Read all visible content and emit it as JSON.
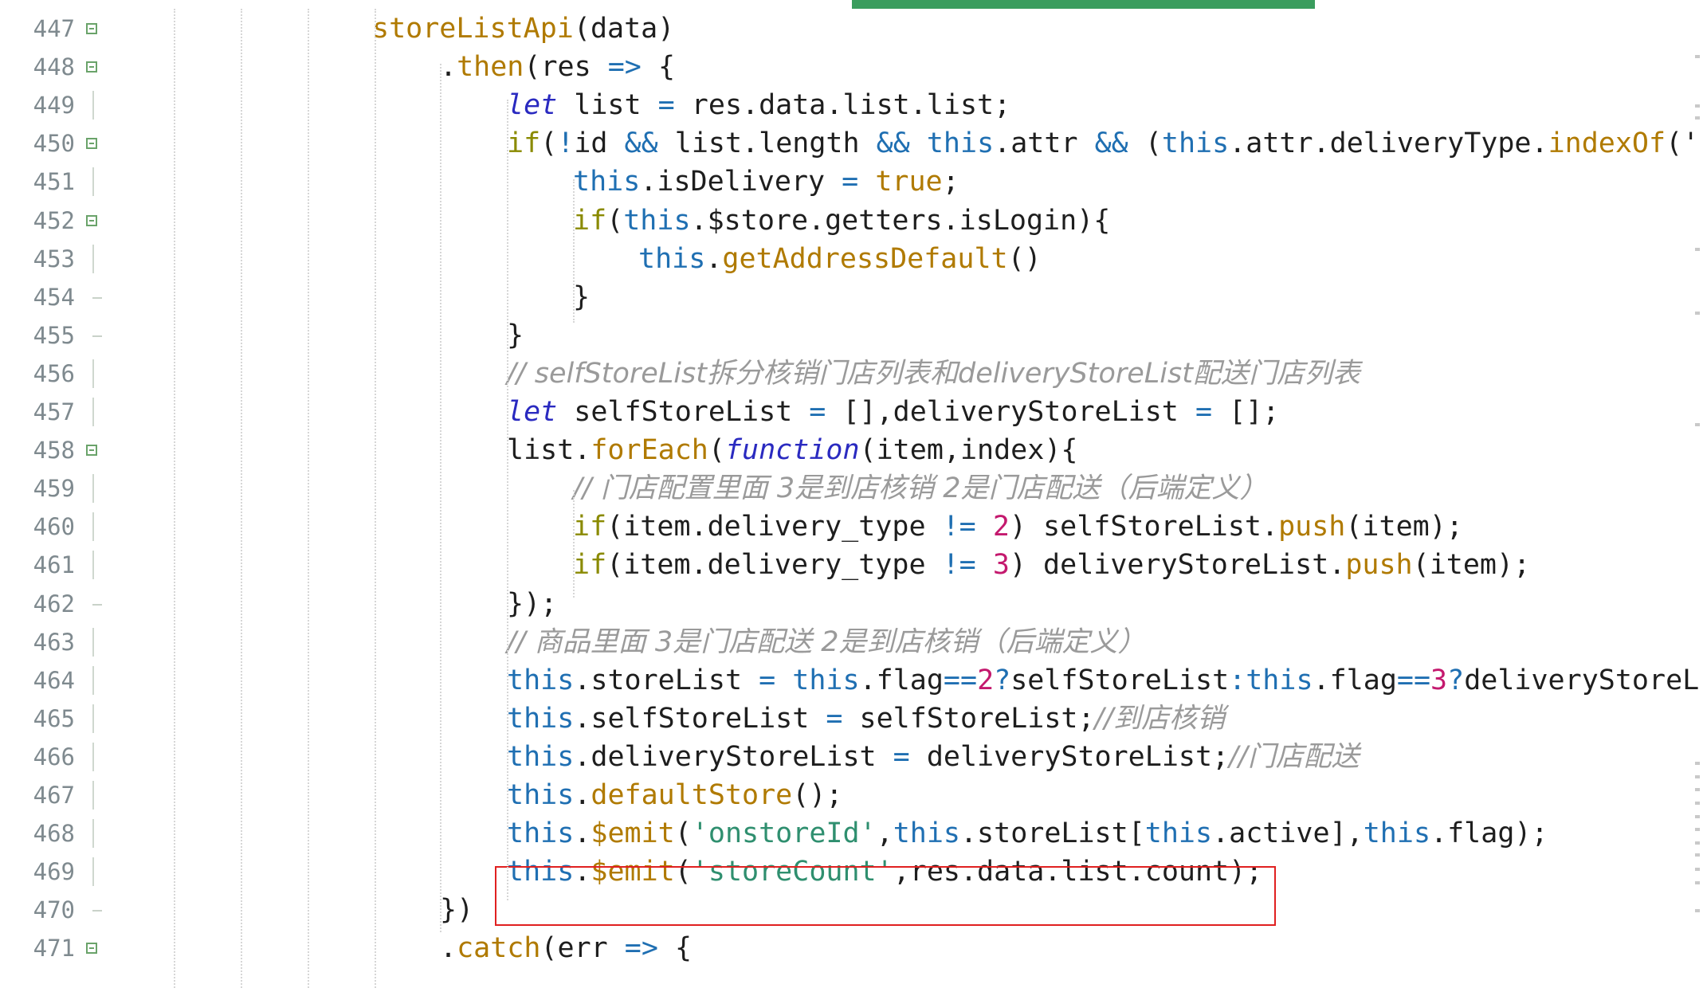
{
  "lines": [
    {
      "num": "447",
      "tokens": [
        {
          "t": "storeListApi",
          "c": "fn"
        },
        {
          "t": "(data)",
          "c": "plain"
        }
      ]
    },
    {
      "num": "448",
      "tokens": [
        {
          "t": ".",
          "c": "plain"
        },
        {
          "t": "then",
          "c": "fn"
        },
        {
          "t": "(res ",
          "c": "plain"
        },
        {
          "t": "=>",
          "c": "op"
        },
        {
          "t": " {",
          "c": "plain"
        }
      ]
    },
    {
      "num": "449",
      "tokens": [
        {
          "t": "let",
          "c": "kw-let"
        },
        {
          "t": " list ",
          "c": "plain"
        },
        {
          "t": "=",
          "c": "op"
        },
        {
          "t": " res.data.list.list;",
          "c": "plain"
        }
      ]
    },
    {
      "num": "450",
      "tokens": [
        {
          "t": "if",
          "c": "kw-if"
        },
        {
          "t": "(",
          "c": "plain"
        },
        {
          "t": "!",
          "c": "op"
        },
        {
          "t": "id ",
          "c": "plain"
        },
        {
          "t": "&&",
          "c": "op"
        },
        {
          "t": " list.length ",
          "c": "plain"
        },
        {
          "t": "&&",
          "c": "op"
        },
        {
          "t": " ",
          "c": "plain"
        },
        {
          "t": "this",
          "c": "kw-this"
        },
        {
          "t": ".attr ",
          "c": "plain"
        },
        {
          "t": "&&",
          "c": "op"
        },
        {
          "t": " (",
          "c": "plain"
        },
        {
          "t": "this",
          "c": "kw-this"
        },
        {
          "t": ".attr.deliveryType.",
          "c": "plain"
        },
        {
          "t": "indexOf",
          "c": "fn"
        },
        {
          "t": "('",
          "c": "plain"
        }
      ]
    },
    {
      "num": "451",
      "tokens": [
        {
          "t": "this",
          "c": "kw-this"
        },
        {
          "t": ".isDelivery ",
          "c": "plain"
        },
        {
          "t": "=",
          "c": "op"
        },
        {
          "t": " ",
          "c": "plain"
        },
        {
          "t": "true",
          "c": "fn"
        },
        {
          "t": ";",
          "c": "plain"
        }
      ]
    },
    {
      "num": "452",
      "tokens": [
        {
          "t": "if",
          "c": "kw-if"
        },
        {
          "t": "(",
          "c": "plain"
        },
        {
          "t": "this",
          "c": "kw-this"
        },
        {
          "t": ".$store.getters.isLogin){",
          "c": "plain"
        }
      ]
    },
    {
      "num": "453",
      "tokens": [
        {
          "t": "this",
          "c": "kw-this"
        },
        {
          "t": ".",
          "c": "plain"
        },
        {
          "t": "getAddressDefault",
          "c": "fn"
        },
        {
          "t": "()",
          "c": "plain"
        }
      ]
    },
    {
      "num": "454",
      "tokens": [
        {
          "t": "}",
          "c": "plain"
        }
      ]
    },
    {
      "num": "455",
      "tokens": [
        {
          "t": "}",
          "c": "plain"
        }
      ]
    },
    {
      "num": "456",
      "tokens": [
        {
          "t": "// selfStoreList拆分核销门店列表和deliveryStoreList配送门店列表",
          "c": "com"
        }
      ]
    },
    {
      "num": "457",
      "tokens": [
        {
          "t": "let",
          "c": "kw-let"
        },
        {
          "t": " selfStoreList ",
          "c": "plain"
        },
        {
          "t": "=",
          "c": "op"
        },
        {
          "t": " [],deliveryStoreList ",
          "c": "plain"
        },
        {
          "t": "=",
          "c": "op"
        },
        {
          "t": " [];",
          "c": "plain"
        }
      ]
    },
    {
      "num": "458",
      "tokens": [
        {
          "t": "list.",
          "c": "plain"
        },
        {
          "t": "forEach",
          "c": "fn"
        },
        {
          "t": "(",
          "c": "plain"
        },
        {
          "t": "function",
          "c": "kw-fn"
        },
        {
          "t": "(item,index){",
          "c": "plain"
        }
      ]
    },
    {
      "num": "459",
      "tokens": [
        {
          "t": "// 门店配置里面 3是到店核销 2是门店配送（后端定义）",
          "c": "com"
        }
      ]
    },
    {
      "num": "460",
      "tokens": [
        {
          "t": "if",
          "c": "kw-if"
        },
        {
          "t": "(item.delivery_type ",
          "c": "plain"
        },
        {
          "t": "!=",
          "c": "op"
        },
        {
          "t": " ",
          "c": "plain"
        },
        {
          "t": "2",
          "c": "num"
        },
        {
          "t": ") selfStoreList.",
          "c": "plain"
        },
        {
          "t": "push",
          "c": "fn"
        },
        {
          "t": "(item);",
          "c": "plain"
        }
      ]
    },
    {
      "num": "461",
      "tokens": [
        {
          "t": "if",
          "c": "kw-if"
        },
        {
          "t": "(item.delivery_type ",
          "c": "plain"
        },
        {
          "t": "!=",
          "c": "op"
        },
        {
          "t": " ",
          "c": "plain"
        },
        {
          "t": "3",
          "c": "num"
        },
        {
          "t": ") deliveryStoreList.",
          "c": "plain"
        },
        {
          "t": "push",
          "c": "fn"
        },
        {
          "t": "(item);",
          "c": "plain"
        }
      ]
    },
    {
      "num": "462",
      "tokens": [
        {
          "t": "});",
          "c": "plain"
        }
      ]
    },
    {
      "num": "463",
      "tokens": [
        {
          "t": "// 商品里面 3是门店配送 2是到店核销（后端定义）",
          "c": "com"
        }
      ]
    },
    {
      "num": "464",
      "tokens": [
        {
          "t": "this",
          "c": "kw-this"
        },
        {
          "t": ".storeList ",
          "c": "plain"
        },
        {
          "t": "=",
          "c": "op"
        },
        {
          "t": " ",
          "c": "plain"
        },
        {
          "t": "this",
          "c": "kw-this"
        },
        {
          "t": ".flag",
          "c": "plain"
        },
        {
          "t": "==",
          "c": "op"
        },
        {
          "t": "2",
          "c": "num"
        },
        {
          "t": "?",
          "c": "op"
        },
        {
          "t": "selfStoreList",
          "c": "plain"
        },
        {
          "t": ":",
          "c": "op"
        },
        {
          "t": "this",
          "c": "kw-this"
        },
        {
          "t": ".flag",
          "c": "plain"
        },
        {
          "t": "==",
          "c": "op"
        },
        {
          "t": "3",
          "c": "num"
        },
        {
          "t": "?",
          "c": "op"
        },
        {
          "t": "deliveryStoreL",
          "c": "plain"
        }
      ]
    },
    {
      "num": "465",
      "tokens": [
        {
          "t": "this",
          "c": "kw-this"
        },
        {
          "t": ".selfStoreList ",
          "c": "plain"
        },
        {
          "t": "=",
          "c": "op"
        },
        {
          "t": " selfStoreList;",
          "c": "plain"
        },
        {
          "t": "//到店核销",
          "c": "com"
        }
      ]
    },
    {
      "num": "466",
      "tokens": [
        {
          "t": "this",
          "c": "kw-this"
        },
        {
          "t": ".deliveryStoreList ",
          "c": "plain"
        },
        {
          "t": "=",
          "c": "op"
        },
        {
          "t": " deliveryStoreList;",
          "c": "plain"
        },
        {
          "t": "//门店配送",
          "c": "com"
        }
      ]
    },
    {
      "num": "467",
      "tokens": [
        {
          "t": "this",
          "c": "kw-this"
        },
        {
          "t": ".",
          "c": "plain"
        },
        {
          "t": "defaultStore",
          "c": "fn"
        },
        {
          "t": "();",
          "c": "plain"
        }
      ]
    },
    {
      "num": "468",
      "tokens": [
        {
          "t": "this",
          "c": "kw-this"
        },
        {
          "t": ".",
          "c": "plain"
        },
        {
          "t": "$emit",
          "c": "fn"
        },
        {
          "t": "(",
          "c": "plain"
        },
        {
          "t": "'onstoreId'",
          "c": "str"
        },
        {
          "t": ",",
          "c": "plain"
        },
        {
          "t": "this",
          "c": "kw-this"
        },
        {
          "t": ".storeList[",
          "c": "plain"
        },
        {
          "t": "this",
          "c": "kw-this"
        },
        {
          "t": ".active],",
          "c": "plain"
        },
        {
          "t": "this",
          "c": "kw-this"
        },
        {
          "t": ".flag);",
          "c": "plain"
        }
      ]
    },
    {
      "num": "469",
      "tokens": [
        {
          "t": "this",
          "c": "kw-this"
        },
        {
          "t": ".",
          "c": "plain"
        },
        {
          "t": "$emit",
          "c": "fn"
        },
        {
          "t": "(",
          "c": "plain"
        },
        {
          "t": "'storeCount'",
          "c": "str"
        },
        {
          "t": ",res.data.list.count);",
          "c": "plain"
        }
      ]
    },
    {
      "num": "470",
      "tokens": [
        {
          "t": "})",
          "c": "plain"
        }
      ]
    },
    {
      "num": "471",
      "tokens": [
        {
          "t": ".",
          "c": "plain"
        },
        {
          "t": "catch",
          "c": "fn"
        },
        {
          "t": "(err ",
          "c": "plain"
        },
        {
          "t": "=>",
          "c": "op"
        },
        {
          "t": " {",
          "c": "plain"
        }
      ]
    }
  ],
  "highlighted_line": "469",
  "colors": {
    "keyword_this": "#1f6fb2",
    "keyword_let": "#2a2ac0",
    "function": "#b07a00",
    "string": "#2f8f6f",
    "number": "#c4196e",
    "comment": "#9a9a9a",
    "highlight_box": "#e02020",
    "active_tab_bar": "#3a9d5e"
  }
}
